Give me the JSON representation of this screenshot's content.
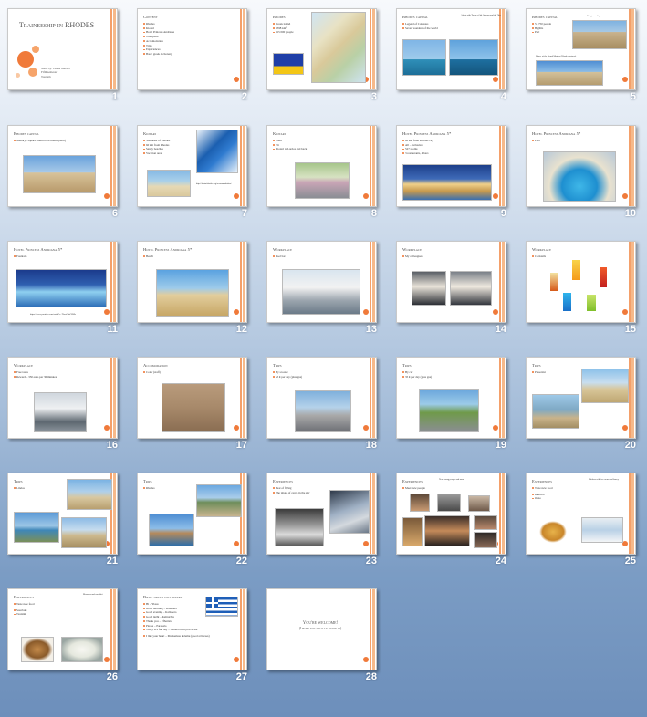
{
  "colors": {
    "accent": "#f07a3a",
    "accent_light": "#f6b98a",
    "background_top": "#f7f9fc",
    "background_bottom": "#6d8fbb"
  },
  "slides": [
    {
      "num": "1",
      "title": "Traineeship in RHODES",
      "lines": [
        "Made by: Tamáš Maraza",
        "Fifth semester",
        "Tourism"
      ]
    },
    {
      "num": "2",
      "title": "Content",
      "bullets": [
        "Rhodes",
        "Kiotari",
        "Hotel Princess Andriana",
        "Workplace",
        "Accomodation",
        "Trips",
        "Experiences",
        "Basic greek dictionary"
      ]
    },
    {
      "num": "3",
      "title": "Rhodes",
      "bullets": [
        "Greek island",
        "1398 km²",
        "115 000 people"
      ]
    },
    {
      "num": "4",
      "title": "Rhodes capital",
      "bullets": [
        "Legend of Colossus",
        "Seven wonders of the world"
      ],
      "note": "Along with Troya of 5th Athenas and the 7th and seventheos"
    },
    {
      "num": "5",
      "title": "Rhodes capital",
      "bullets": [
        "53 750 people",
        "Bigthis",
        "Port"
      ],
      "note": "Palace of the Grand Masters (Rhodes fortress)",
      "note2": "Kaligonare Square"
    },
    {
      "num": "6",
      "title": "Rhodes capital",
      "bullets": [
        "Mandrys Square (Main local marketplace)"
      ]
    },
    {
      "num": "7",
      "title": "Kiotari",
      "bullets": [
        "Southeast of Rhodes",
        "60 km from Rhodes",
        "Sandy beaches",
        "Vacation area"
      ],
      "note": "http://kiotarirhodes.org/accommodation/"
    },
    {
      "num": "8",
      "title": "Kiotari",
      "bullets": [
        "Train",
        "3 €",
        "Kiotari to Lardos and back"
      ]
    },
    {
      "num": "9",
      "title": "Hotel Princess Andriana 5*",
      "bullets": [
        "60 km from Rhodes city",
        "All – inclusive",
        "527 rooms",
        "3 restaurants, 4 bars"
      ]
    },
    {
      "num": "10",
      "title": "Hotel Princess Andriana 5*",
      "bullets": [
        "Pool"
      ]
    },
    {
      "num": "11",
      "title": "Hotel Princess Andriana 5*",
      "bullets": [
        "Fountain"
      ],
      "note": "https://www.youtube.com/watch?v=ThcnG0nO9Ma"
    },
    {
      "num": "12",
      "title": "Hotel Princess Andriana 5*",
      "bullets": [
        "Beach"
      ]
    },
    {
      "num": "13",
      "title": "Workplace",
      "bullets": [
        "Pool bar"
      ]
    },
    {
      "num": "14",
      "title": "Workplace",
      "bullets": [
        "My colleagues"
      ]
    },
    {
      "num": "15",
      "title": "Workplace",
      "bullets": [
        "Cocktails"
      ]
    },
    {
      "num": "16",
      "title": "Workplace",
      "bullets": [
        "Free tasks",
        "Reward – 350 euro per 30 minutes"
      ]
    },
    {
      "num": "17",
      "title": "Accomodation",
      "bullets": [
        "Color (staff)"
      ]
    },
    {
      "num": "18",
      "title": "Trips",
      "bullets": [
        "By scooter",
        "25 € per day (plus gas)"
      ]
    },
    {
      "num": "19",
      "title": "Trips",
      "bullets": [
        "By car",
        "35 € per day (plus gas)"
      ]
    },
    {
      "num": "20",
      "title": "Trips",
      "bullets": [
        "Prasonisi"
      ]
    },
    {
      "num": "21",
      "title": "Trips",
      "bullets": [
        "Lindos"
      ]
    },
    {
      "num": "22",
      "title": "Trips",
      "bullets": [
        "Rhodes"
      ]
    },
    {
      "num": "23",
      "title": "Experiences",
      "bullets": [
        "Fear of flying",
        "The photo of cargo in the sky"
      ]
    },
    {
      "num": "24",
      "title": "Experiences",
      "bullets": [
        "Meet new people"
      ],
      "note": "New young people and more"
    },
    {
      "num": "25",
      "title": "Experiences",
      "bullets": [
        "Taste new food",
        "Baklava",
        "Ouzo"
      ],
      "note": "Baklava with ice cream and honey"
    },
    {
      "num": "26",
      "title": "Experiences",
      "bullets": [
        "Taste new food",
        "Souvlaki",
        "Tzatziki"
      ],
      "note": "Mousaka and souvlaki"
    },
    {
      "num": "27",
      "title": "Basic greek dictionary",
      "bullets": [
        "Hi – Yiasu",
        "Good morning – Kalimera",
        "Good evening – Kalispera",
        "Good night – Kalinichta",
        "Thank you – Efharisto",
        "Please – Parakalo",
        "Today is a fun day – Simera einai poli wraia",
        "I like your heart – Matisemou kolemu (good at horses)"
      ]
    },
    {
      "num": "28",
      "title": "You're welcome!",
      "subtitle": "(I hope you really enjoy it)"
    }
  ]
}
